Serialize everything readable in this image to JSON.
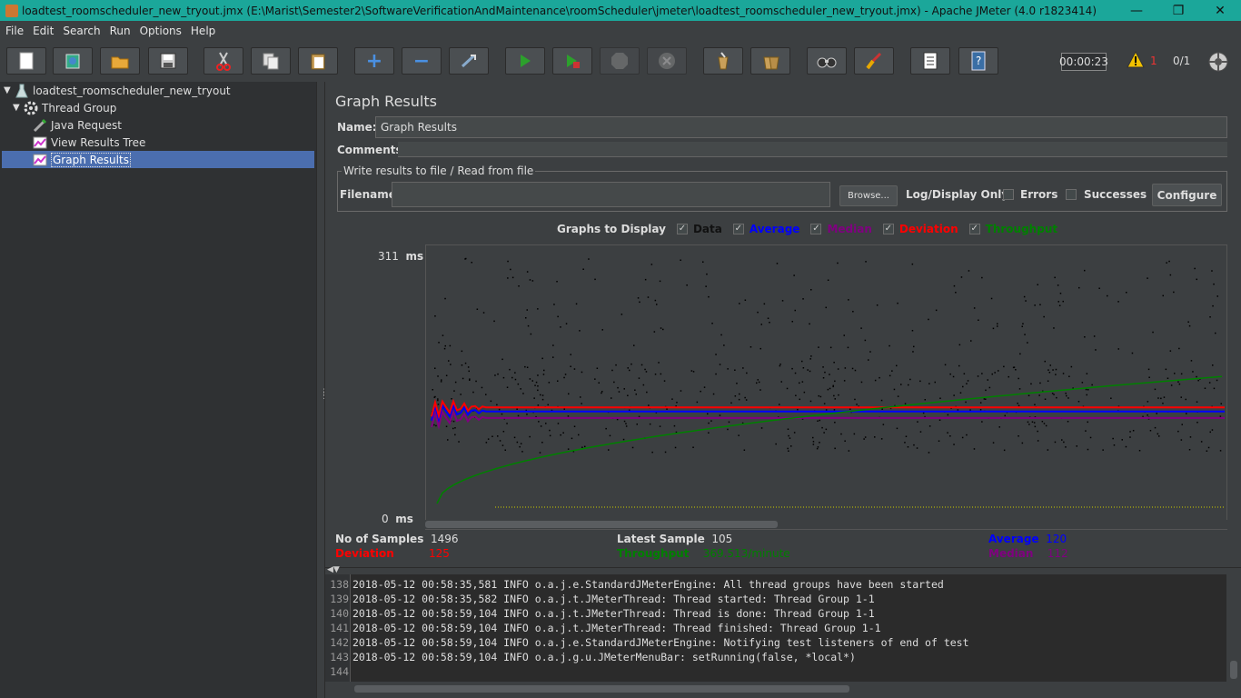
{
  "window": {
    "title": "loadtest_roomscheduler_new_tryout.jmx (E:\\Marist\\Semester2\\SoftwareVerificationAndMaintenance\\roomScheduler\\jmeter\\loadtest_roomscheduler_new_tryout.jmx) - Apache JMeter (4.0 r1823414)",
    "minimize": "—",
    "restore": "❐",
    "close": "✕"
  },
  "menu": [
    "File",
    "Edit",
    "Search",
    "Run",
    "Options",
    "Help"
  ],
  "toolbar": {
    "icons": [
      "new-icon",
      "templates-icon",
      "open-icon",
      "save-icon",
      "cut-icon",
      "copy-icon",
      "paste-icon",
      "expand-icon",
      "collapse-icon",
      "toggle-icon",
      "start-icon",
      "start-no-pause-icon",
      "stop-icon",
      "shutdown-icon",
      "clear-icon",
      "clear-all-icon",
      "search-icon",
      "reset-search-icon",
      "function-helper-icon",
      "help-icon"
    ],
    "timer": "00:00:23",
    "warning_count": "1",
    "threads": "0/1"
  },
  "tree": [
    {
      "label": "loadtest_roomscheduler_new_tryout",
      "icon": "test-plan-icon"
    },
    {
      "label": "Thread Group",
      "icon": "thread-group-icon"
    },
    {
      "label": "Java Request",
      "icon": "sampler-icon"
    },
    {
      "label": "View Results Tree",
      "icon": "listener-icon"
    },
    {
      "label": "Graph Results",
      "icon": "listener-icon"
    }
  ],
  "panel": {
    "title": "Graph Results",
    "name_label": "Name:",
    "name_value": "Graph Results",
    "comments_label": "Comments:",
    "file_legend": "Write results to file / Read from file",
    "filename_label": "Filename",
    "browse": "Browse...",
    "log_display_only": "Log/Display Only:",
    "errors": "Errors",
    "successes": "Successes",
    "configure": "Configure"
  },
  "graphs": {
    "label": "Graphs to Display",
    "items": [
      {
        "label": "Data",
        "color": "#000000"
      },
      {
        "label": "Average",
        "color": "#0000ff"
      },
      {
        "label": "Median",
        "color": "#800080"
      },
      {
        "label": "Deviation",
        "color": "#ff0000"
      },
      {
        "label": "Throughput",
        "color": "#008000"
      }
    ],
    "y_max": "311",
    "y_min": "0",
    "unit": "ms"
  },
  "chart_data": {
    "type": "line",
    "y_max_ms": 311,
    "y_min_ms": 0,
    "series": [
      {
        "name": "Average",
        "level_ms": 120
      },
      {
        "name": "Deviation",
        "level_ms": 125
      },
      {
        "name": "Median",
        "level_ms": 112
      },
      {
        "name": "Throughput",
        "level_per_minute": 369.513
      }
    ]
  },
  "stats": {
    "samples_label": "No of Samples",
    "samples_value": "1496",
    "latest_label": "Latest Sample",
    "latest_value": "105",
    "average_label": "Average",
    "average_value": "120",
    "deviation_label": "Deviation",
    "deviation_value": "125",
    "throughput_label": "Throughput",
    "throughput_value": "369.513/minute",
    "median_label": "Median",
    "median_value": "112"
  },
  "log": [
    {
      "n": "138",
      "text": "2018-05-12 00:58:35,581 INFO o.a.j.e.StandardJMeterEngine: All thread groups have been started"
    },
    {
      "n": "139",
      "text": "2018-05-12 00:58:35,582 INFO o.a.j.t.JMeterThread: Thread started: Thread Group 1-1"
    },
    {
      "n": "140",
      "text": "2018-05-12 00:58:59,104 INFO o.a.j.t.JMeterThread: Thread is done: Thread Group 1-1"
    },
    {
      "n": "141",
      "text": "2018-05-12 00:58:59,104 INFO o.a.j.t.JMeterThread: Thread finished: Thread Group 1-1"
    },
    {
      "n": "142",
      "text": "2018-05-12 00:58:59,104 INFO o.a.j.e.StandardJMeterEngine: Notifying test listeners of end of test"
    },
    {
      "n": "143",
      "text": "2018-05-12 00:58:59,104 INFO o.a.j.g.u.JMeterMenuBar: setRunning(false, *local*)"
    },
    {
      "n": "144",
      "text": ""
    }
  ]
}
